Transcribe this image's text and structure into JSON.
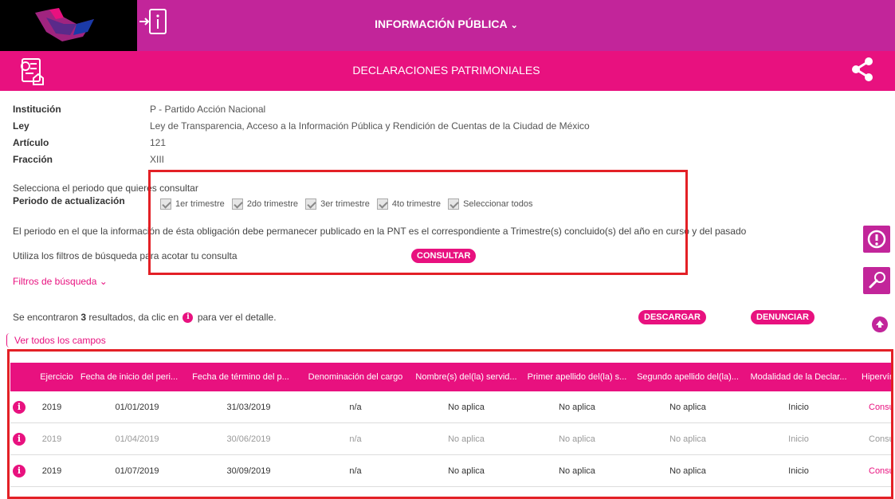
{
  "header": {
    "title": "INFORMACIÓN PÚBLICA",
    "subtitle": "DECLARACIONES PATRIMONIALES"
  },
  "meta": [
    {
      "label": "Institución",
      "value": "P - Partido Acción Nacional"
    },
    {
      "label": "Ley",
      "value": "Ley de Transparencia, Acceso a la Información Pública y Rendición de Cuentas de la Ciudad de México"
    },
    {
      "label": "Artículo",
      "value": "121"
    },
    {
      "label": "Fracción",
      "value": "XIII"
    }
  ],
  "period": {
    "prompt": "Selecciona el periodo que quieres consultar",
    "label": "Periodo de actualización",
    "options": [
      {
        "label": "1er trimestre",
        "checked": true
      },
      {
        "label": "2do trimestre",
        "checked": true
      },
      {
        "label": "3er trimestre",
        "checked": true
      },
      {
        "label": "4to trimestre",
        "checked": true
      },
      {
        "label": "Seleccionar todos",
        "checked": true
      }
    ],
    "note": "El periodo en el que la información de ésta obligación debe permanecer publicado en la PNT es el correspondiente a Trimestre(s) concluido(s) del año en curso y del pasado",
    "filters_hint": "Utiliza los filtros de búsqueda para acotar tu consulta",
    "consult_label": "CONSULTAR"
  },
  "filters_label": "Filtros de búsqueda",
  "results": {
    "prefix": "Se encontraron ",
    "count": "3",
    "middle": " resultados, da clic en ",
    "suffix": " para ver el detalle.",
    "download_label": "DESCARGAR",
    "denounce_label": "DENUNCIAR",
    "view_all": "Ver todos los campos"
  },
  "table": {
    "columns": [
      "Ejercicio",
      "Fecha de inicio del peri...",
      "Fecha de término del p...",
      "Denominación del cargo",
      "Nombre(s) del(la) servid...",
      "Primer apellido del(la) s...",
      "Segundo apellido del(la)...",
      "Modalidad de la Declar...",
      "Hipervínculo"
    ],
    "rows": [
      [
        "2019",
        "01/01/2019",
        "31/03/2019",
        "n/a",
        "No aplica",
        "No aplica",
        "No aplica",
        "Inicio",
        "Consulta"
      ],
      [
        "2019",
        "01/04/2019",
        "30/06/2019",
        "n/a",
        "No aplica",
        "No aplica",
        "No aplica",
        "Inicio",
        "Consulta"
      ],
      [
        "2019",
        "01/07/2019",
        "30/09/2019",
        "n/a",
        "No aplica",
        "No aplica",
        "No aplica",
        "Inicio",
        "Consulta"
      ]
    ]
  },
  "colors": {
    "magenta": "#c2259a",
    "pink": "#e8117f",
    "highlight_red": "#e32026"
  },
  "icons": [
    "logo",
    "info-login-icon",
    "document-icon",
    "share-icon",
    "alert-icon",
    "wrench-icon",
    "scroll-up-icon",
    "info-icon"
  ]
}
